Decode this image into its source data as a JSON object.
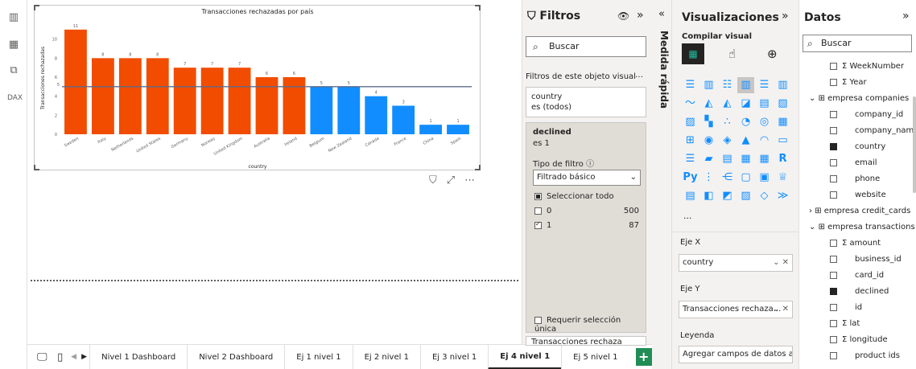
{
  "chart_data": {
    "type": "bar",
    "title": "Transacciones rechazadas por país",
    "xlabel": "country",
    "ylabel": "Transacciones rechazadas",
    "ylim": [
      0,
      12
    ],
    "yticks": [
      0,
      2,
      4,
      6,
      8,
      10
    ],
    "average_line": 5,
    "categories": [
      "Sweden",
      "Italy",
      "Netherlands",
      "United States",
      "Germany",
      "Norway",
      "United Kingdom",
      "Australia",
      "Ireland",
      "Belgium",
      "New Zealand",
      "Canada",
      "France",
      "China",
      "Spain"
    ],
    "values": [
      11,
      8,
      8,
      8,
      7,
      7,
      7,
      6,
      6,
      5,
      5,
      4,
      3,
      1,
      1
    ],
    "colors": [
      "#f24c00",
      "#f24c00",
      "#f24c00",
      "#f24c00",
      "#f24c00",
      "#f24c00",
      "#f24c00",
      "#f24c00",
      "#f24c00",
      "#118dff",
      "#118dff",
      "#118dff",
      "#118dff",
      "#118dff",
      "#118dff"
    ]
  },
  "tabs": [
    "Nivel 1 Dashboard",
    "Nivel 2 Dashboard",
    "Ej 1 nivel 1",
    "Ej 2 nivel 1",
    "Ej 3 nivel 1",
    "Ej 4 nivel 1",
    "Ej 5 nivel 1"
  ],
  "active_tab": "Ej 4 nivel 1",
  "filters": {
    "title": "Filtros",
    "search_placeholder": "Buscar",
    "section_label": "Filtros de este objeto visual",
    "card1_field": "country",
    "card1_value": "es (todos)",
    "card2_field": "declined",
    "card2_value": "es 1",
    "filter_type_label": "Tipo de filtro ⓘ",
    "filter_type_value": "Filtrado básico",
    "select_all": "Seleccionar todo",
    "item0_label": "0",
    "item0_count": "500",
    "item1_label": "1",
    "item1_count": "87",
    "require_single": "Requerir selección única",
    "next_card": "Transacciones rechaza"
  },
  "medida": "Medida rápida",
  "viz": {
    "title": "Visualizaciones",
    "subtitle": "Compilar visual",
    "more": "...",
    "eje_x_label": "Eje X",
    "eje_x_value": "country",
    "eje_y_label": "Eje Y",
    "eje_y_value": "Transacciones rechaza...",
    "leyenda_label": "Leyenda",
    "leyenda_value": "Agregar campos de datos a..."
  },
  "data_pane": {
    "title": "Datos",
    "search_placeholder": "Buscar",
    "fields": [
      {
        "label": "WeekNumber",
        "sigma": true,
        "checked": false
      },
      {
        "label": "Year",
        "sigma": true,
        "checked": false
      }
    ],
    "companies_table": "empresa companies",
    "companies_fields": [
      {
        "label": "company_id",
        "checked": false
      },
      {
        "label": "company_name",
        "checked": false
      },
      {
        "label": "country",
        "checked": true
      },
      {
        "label": "email",
        "checked": false
      },
      {
        "label": "phone",
        "checked": false
      },
      {
        "label": "website",
        "checked": false
      }
    ],
    "credit_table": "empresa credit_cards",
    "transactions_table": "empresa transactions",
    "transactions_fields": [
      {
        "label": "amount",
        "sigma": true,
        "checked": false
      },
      {
        "label": "business_id",
        "checked": false
      },
      {
        "label": "card_id",
        "checked": false
      },
      {
        "label": "declined",
        "checked": true
      },
      {
        "label": "id",
        "checked": false
      },
      {
        "label": "lat",
        "sigma": true,
        "checked": false
      },
      {
        "label": "longitude",
        "sigma": true,
        "checked": false
      },
      {
        "label": "product ids",
        "checked": false
      }
    ]
  }
}
